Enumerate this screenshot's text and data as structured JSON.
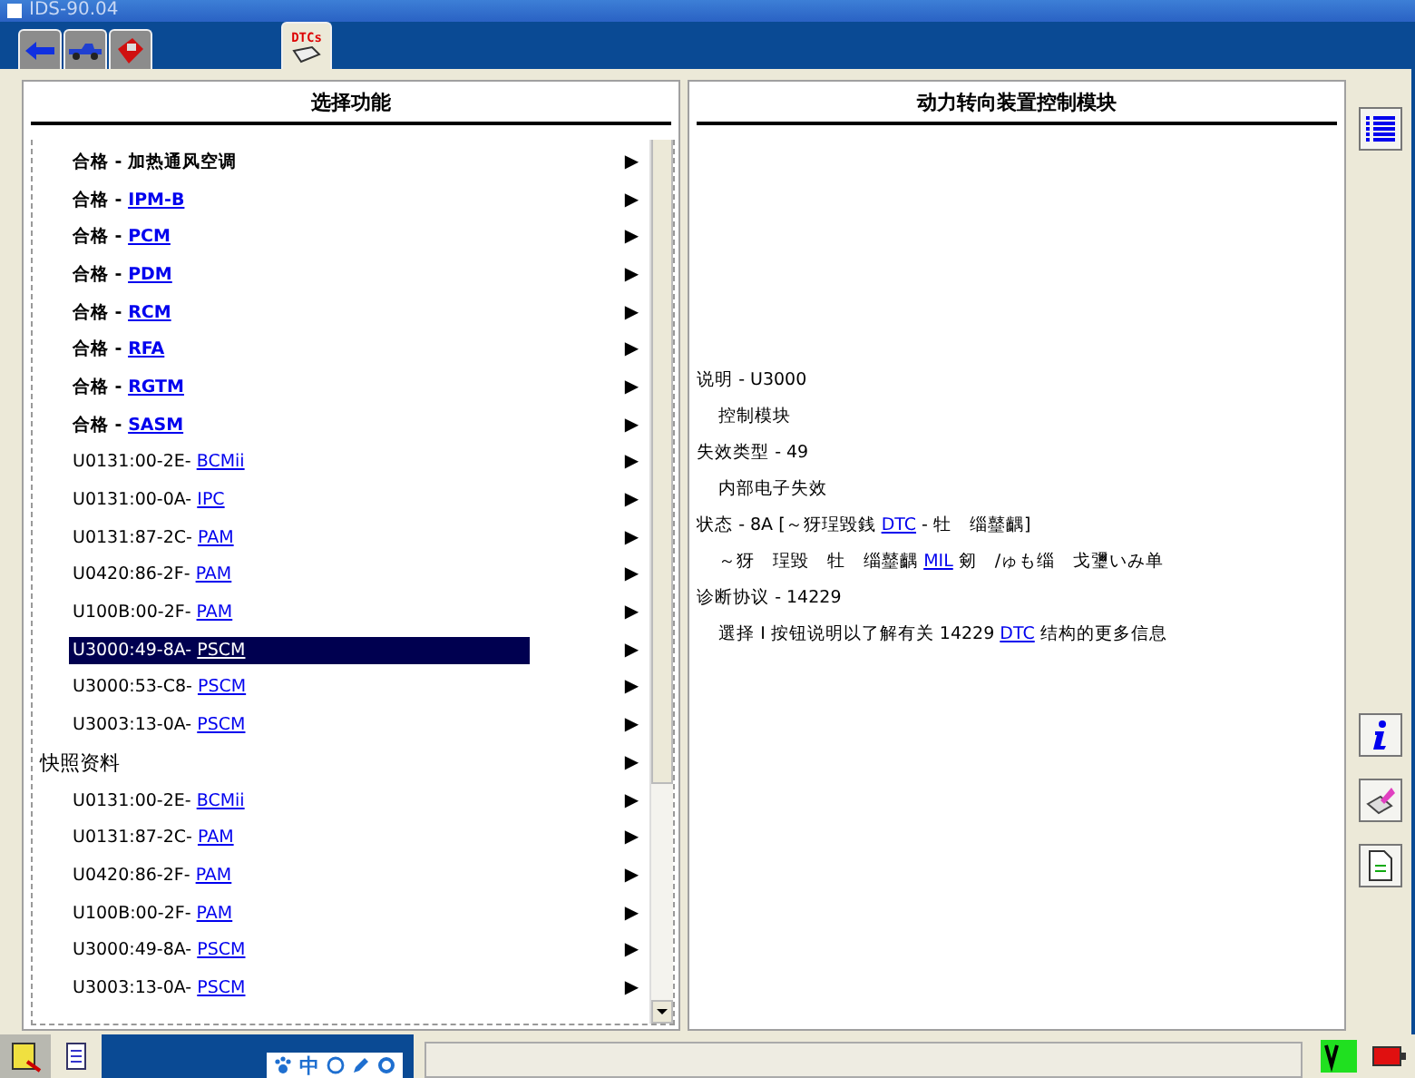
{
  "window": {
    "title": "IDS-90.04"
  },
  "tabs": [
    {
      "kind": "back",
      "selected": false
    },
    {
      "kind": "vehicle",
      "selected": false
    },
    {
      "kind": "toolbox",
      "selected": false
    },
    {
      "kind": "dtc",
      "label": "DTCs",
      "selected": true
    }
  ],
  "left_panel": {
    "title": "选择功能",
    "rows": [
      {
        "kind": "item",
        "prefix": "合格 - 加热通风空调",
        "arrow": "▶",
        "selected": false
      },
      {
        "kind": "item",
        "prefix": "合格 - ",
        "link": "IPM-B",
        "arrow": "▶",
        "selected": false
      },
      {
        "kind": "item",
        "prefix": "合格 - ",
        "link": "PCM",
        "arrow": "▶",
        "selected": false
      },
      {
        "kind": "item",
        "prefix": "合格 - ",
        "link": "PDM",
        "arrow": "▶",
        "selected": false
      },
      {
        "kind": "item",
        "prefix": "合格 - ",
        "link": "RCM",
        "arrow": "▶",
        "selected": false
      },
      {
        "kind": "item",
        "prefix": "合格 - ",
        "link": "RFA",
        "arrow": "▶",
        "selected": false
      },
      {
        "kind": "item",
        "prefix": "合格 - ",
        "link": "RGTM",
        "arrow": "▶",
        "selected": false
      },
      {
        "kind": "item",
        "prefix": "合格 - ",
        "link": "SASM",
        "arrow": "▶",
        "selected": false
      },
      {
        "kind": "item",
        "prefix": "U0131:00-2E- ",
        "link": "BCMii",
        "arrow": "▶",
        "selected": false
      },
      {
        "kind": "item",
        "prefix": "U0131:00-0A- ",
        "link": "IPC",
        "arrow": "▶",
        "selected": false
      },
      {
        "kind": "item",
        "prefix": "U0131:87-2C- ",
        "link": "PAM",
        "arrow": "▶",
        "selected": false
      },
      {
        "kind": "item",
        "prefix": "U0420:86-2F- ",
        "link": "PAM",
        "arrow": "▶",
        "selected": false
      },
      {
        "kind": "item",
        "prefix": "U100B:00-2F- ",
        "link": "PAM",
        "arrow": "▶",
        "selected": false
      },
      {
        "kind": "item",
        "prefix": "U3000:49-8A- ",
        "link": "PSCM",
        "arrow": "▶",
        "selected": true
      },
      {
        "kind": "item",
        "prefix": "U3000:53-C8- ",
        "link": "PSCM",
        "arrow": "▶",
        "selected": false
      },
      {
        "kind": "item",
        "prefix": "U3003:13-0A- ",
        "link": "PSCM",
        "arrow": "▶",
        "selected": false
      },
      {
        "kind": "header",
        "prefix": "快照资料",
        "arrow": "▶"
      },
      {
        "kind": "item",
        "prefix": "U0131:00-2E- ",
        "link": "BCMii",
        "arrow": "▶",
        "selected": false
      },
      {
        "kind": "item",
        "prefix": "U0131:87-2C- ",
        "link": "PAM",
        "arrow": "▶",
        "selected": false
      },
      {
        "kind": "item",
        "prefix": "U0420:86-2F- ",
        "link": "PAM",
        "arrow": "▶",
        "selected": false
      },
      {
        "kind": "item",
        "prefix": "U100B:00-2F- ",
        "link": "PAM",
        "arrow": "▶",
        "selected": false
      },
      {
        "kind": "item",
        "prefix": "U3000:49-8A- ",
        "link": "PSCM",
        "arrow": "▶",
        "selected": false
      },
      {
        "kind": "item",
        "prefix": "U3003:13-0A- ",
        "link": "PSCM",
        "arrow": "▶",
        "selected": false
      }
    ]
  },
  "right_panel": {
    "title": "动力转向装置控制模块",
    "lines": [
      {
        "kind": "label",
        "parts": [
          {
            "text": "说明 - U3000",
            "link": false
          }
        ]
      },
      {
        "kind": "indent",
        "parts": [
          {
            "text": "控制模块",
            "link": false
          }
        ]
      },
      {
        "kind": "label",
        "parts": [
          {
            "text": "失效类型 - 49",
            "link": false
          }
        ]
      },
      {
        "kind": "indent",
        "parts": [
          {
            "text": "内部电子失效",
            "link": false
          }
        ]
      },
      {
        "kind": "label",
        "parts": [
          {
            "text": "状态 - 8A [～犽珵毀銭 ",
            "link": false
          },
          {
            "text": "DTC",
            "link": true
          },
          {
            "text": " - 牡　缁鼞齵]",
            "link": false
          }
        ]
      },
      {
        "kind": "indent",
        "parts": [
          {
            "text": "～犽　珵毀　牡　缁鼞齵 ",
            "link": false
          },
          {
            "text": "MIL",
            "link": true
          },
          {
            "text": " 剱　/ゅも缁　戈瓕いみ单",
            "link": false
          }
        ]
      },
      {
        "kind": "label",
        "parts": [
          {
            "text": "诊断协议 - 14229",
            "link": false
          }
        ]
      },
      {
        "kind": "indent",
        "parts": [
          {
            "text": "選择 I 按钮说明以了解有关 14229 ",
            "link": false
          },
          {
            "text": "DTC",
            "link": true
          },
          {
            "text": " 结构的更多信息",
            "link": false
          }
        ]
      }
    ]
  },
  "side_tools": [
    {
      "kind": "list"
    },
    {
      "kind": "info"
    },
    {
      "kind": "eraser"
    },
    {
      "kind": "document"
    }
  ],
  "taskbar": {
    "ime_label": "中"
  }
}
